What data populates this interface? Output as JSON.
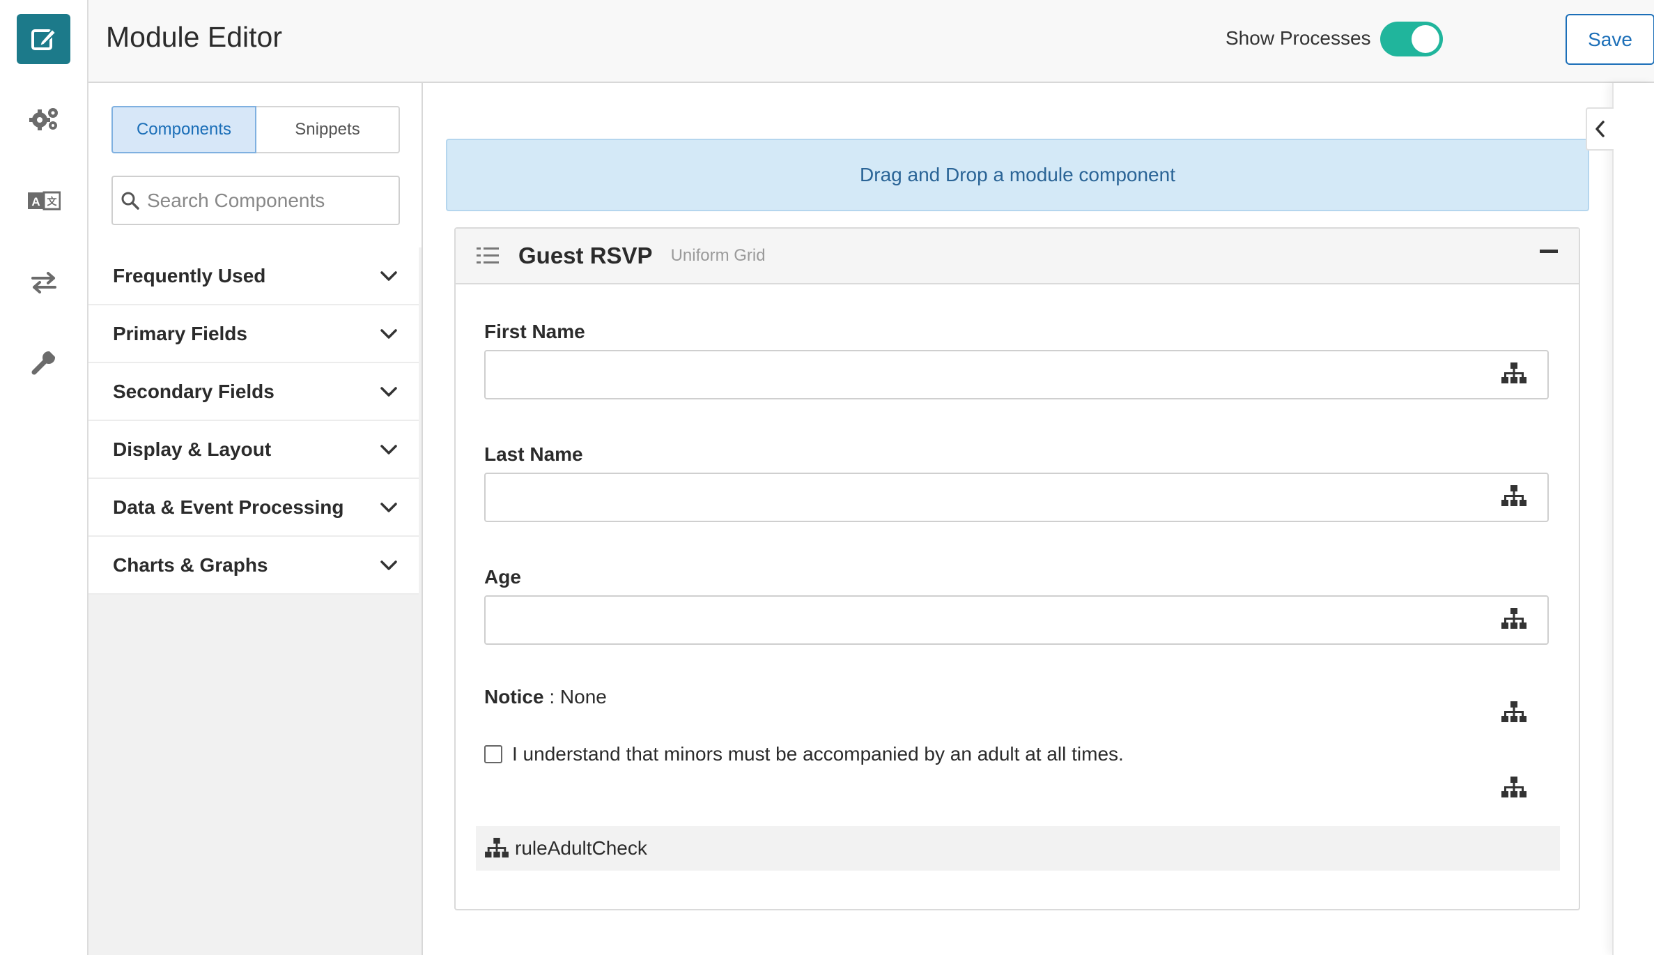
{
  "header": {
    "title": "Module Editor",
    "show_processes_label": "Show Processes",
    "show_processes_on": true,
    "save_label": "Save",
    "more_label": "•••"
  },
  "rail": {
    "items": [
      "edit-icon",
      "settings-icon",
      "translate-icon",
      "transfer-icon",
      "wrench-icon"
    ]
  },
  "panel": {
    "tabs": [
      "Components",
      "Snippets"
    ],
    "active_tab": "Components",
    "search_placeholder": "Search Components",
    "categories": [
      "Frequently Used",
      "Primary Fields",
      "Secondary Fields",
      "Display & Layout",
      "Data & Event Processing",
      "Charts & Graphs"
    ]
  },
  "canvas": {
    "drop_zone": "Drag and Drop a module component",
    "component": {
      "name": "Guest RSVP",
      "type": "Uniform Grid",
      "fields": [
        {
          "label": "First Name",
          "value": ""
        },
        {
          "label": "Last Name",
          "value": ""
        },
        {
          "label": "Age",
          "value": ""
        }
      ],
      "notice_label": "Notice",
      "notice_sep": " : ",
      "notice_value": "None",
      "checkbox_label": "I understand that minors must be accompanied by an adult at all times.",
      "checkbox_checked": false,
      "rule_name": "ruleAdultCheck"
    }
  },
  "colors": {
    "brand": "#1c7a8a",
    "toggle_on": "#20b59c",
    "primary": "#1c6fb8",
    "drop_bg": "#d4e9f7"
  }
}
